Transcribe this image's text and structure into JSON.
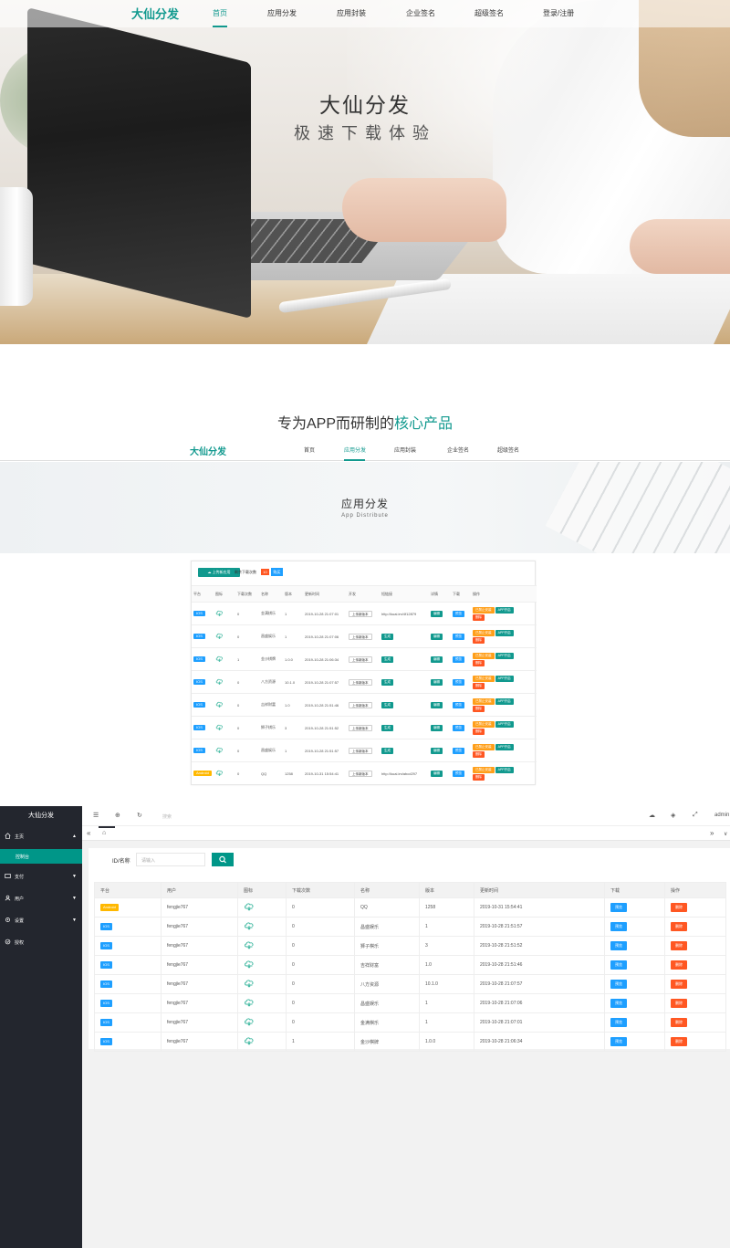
{
  "nav": {
    "logo": "大仙分发",
    "links": [
      "首页",
      "应用分发",
      "应用封装",
      "企业签名",
      "超级签名",
      "登录/注册"
    ],
    "active_index": 0
  },
  "hero": {
    "title": "大仙分发",
    "subtitle": "极速下载体验"
  },
  "section2": {
    "title_prefix": "专为APP而研制的",
    "title_highlight": "核心产品"
  },
  "nav2": {
    "logo": "大仙分发",
    "links": [
      "首页",
      "应用分发",
      "应用封装",
      "企业签名",
      "超级签名"
    ],
    "active_index": 1
  },
  "banner": {
    "title": "应用分发",
    "subtitle": "App Distribute"
  },
  "panel": {
    "upload_label": "上传新应用",
    "remaining_label": "剩余下载次数",
    "remaining_count": "10",
    "buy_label": "购买",
    "columns": [
      "平台",
      "图标",
      "下载次数",
      "名称",
      "版本",
      "更新时间",
      "开发",
      "短链接",
      "详情",
      "下载",
      "操作"
    ],
    "rows": [
      {
        "platform": "IOS",
        "downloads": "0",
        "name": "金满棋乐",
        "version": "1",
        "time": "2019-10-28 21:07:01",
        "dev": "上传新版本",
        "link": "http://kuai.im/4f12879",
        "has_gen": false
      },
      {
        "platform": "IOS",
        "downloads": "0",
        "name": "昌盛娱乐",
        "version": "1",
        "time": "2019-10-28 21:07:06",
        "dev": "上传新版本",
        "link": "",
        "has_gen": true
      },
      {
        "platform": "IOS",
        "downloads": "1",
        "name": "金沙棋牌",
        "version": "1.0.0",
        "time": "2019-10-28 21:06:34",
        "dev": "上传新版本",
        "link": "",
        "has_gen": true
      },
      {
        "platform": "IOS",
        "downloads": "0",
        "name": "八方资源",
        "version": "10.1.0",
        "time": "2019-10-28 21:07:57",
        "dev": "上传新版本",
        "link": "",
        "has_gen": true
      },
      {
        "platform": "IOS",
        "downloads": "0",
        "name": "吉祥财富",
        "version": "1.0",
        "time": "2019-10-28 21:51:46",
        "dev": "上传新版本",
        "link": "",
        "has_gen": true
      },
      {
        "platform": "IOS",
        "downloads": "0",
        "name": "狮子棋乐",
        "version": "3",
        "time": "2019-10-28 21:51:52",
        "dev": "上传新版本",
        "link": "",
        "has_gen": true
      },
      {
        "platform": "IOS",
        "downloads": "0",
        "name": "昌盛娱乐",
        "version": "1",
        "time": "2019-10-28 21:51:57",
        "dev": "上传新版本",
        "link": "",
        "has_gen": true
      },
      {
        "platform": "Android",
        "downloads": "0",
        "name": "QQ",
        "version": "1258",
        "time": "2019-10-31 15:54:41",
        "dev": "上传新版本",
        "link": "http://kuai.im/abcd297",
        "has_gen": false
      }
    ],
    "gen_label": "生成",
    "edit_label": "编辑",
    "preview_label": "预览",
    "action1_label": "已禁止安装",
    "action2_label": "APP开启",
    "delete_label": "删除"
  },
  "admin": {
    "sidebar_title": "大仙分发",
    "menu": [
      {
        "label": "主页",
        "icon": "home-icon",
        "arrow": "▲"
      },
      {
        "label": "支付",
        "icon": "pay-icon",
        "arrow": "▼"
      },
      {
        "label": "用户",
        "icon": "user-icon",
        "arrow": "▼"
      },
      {
        "label": "设置",
        "icon": "settings-icon",
        "arrow": "▼"
      },
      {
        "label": "授权",
        "icon": "auth-icon",
        "arrow": ""
      }
    ],
    "submenu_active": "控制台",
    "topbar": {
      "search_placeholder": "搜索",
      "user": "admin"
    },
    "search": {
      "label": "ID/名称",
      "placeholder": "请输入"
    },
    "columns": [
      "平台",
      "用户",
      "图标",
      "下载次数",
      "名称",
      "版本",
      "更新时间",
      "下载",
      "操作"
    ],
    "preview_label": "预览",
    "delete_label": "删除",
    "rows": [
      {
        "platform": "Android",
        "user": "fengjie767",
        "downloads": "0",
        "name": "QQ",
        "version": "1258",
        "time": "2019-10-31 15:54:41"
      },
      {
        "platform": "IOS",
        "user": "fengjie767",
        "downloads": "0",
        "name": "昌盛娱乐",
        "version": "1",
        "time": "2019-10-28 21:51:57"
      },
      {
        "platform": "IOS",
        "user": "fengjie767",
        "downloads": "0",
        "name": "狮子棋乐",
        "version": "3",
        "time": "2019-10-28 21:51:52"
      },
      {
        "platform": "IOS",
        "user": "fengjie767",
        "downloads": "0",
        "name": "吉祥财富",
        "version": "1.0",
        "time": "2019-10-28 21:51:46"
      },
      {
        "platform": "IOS",
        "user": "fengjie767",
        "downloads": "0",
        "name": "八方资源",
        "version": "10.1.0",
        "time": "2019-10-28 21:07:57"
      },
      {
        "platform": "IOS",
        "user": "fengjie767",
        "downloads": "0",
        "name": "昌盛娱乐",
        "version": "1",
        "time": "2019-10-28 21:07:06"
      },
      {
        "platform": "IOS",
        "user": "fengjie767",
        "downloads": "0",
        "name": "金满棋乐",
        "version": "1",
        "time": "2019-10-28 21:07:01"
      },
      {
        "platform": "IOS",
        "user": "fengjie767",
        "downloads": "1",
        "name": "金沙棋牌",
        "version": "1.0.0",
        "time": "2019-10-28 21:06:34"
      }
    ]
  },
  "colors": {
    "brand": "#11998e",
    "ios": "#1e9fff",
    "android": "#ffb800",
    "danger": "#ff5722",
    "sidebar": "#23262e",
    "active": "#009688"
  }
}
